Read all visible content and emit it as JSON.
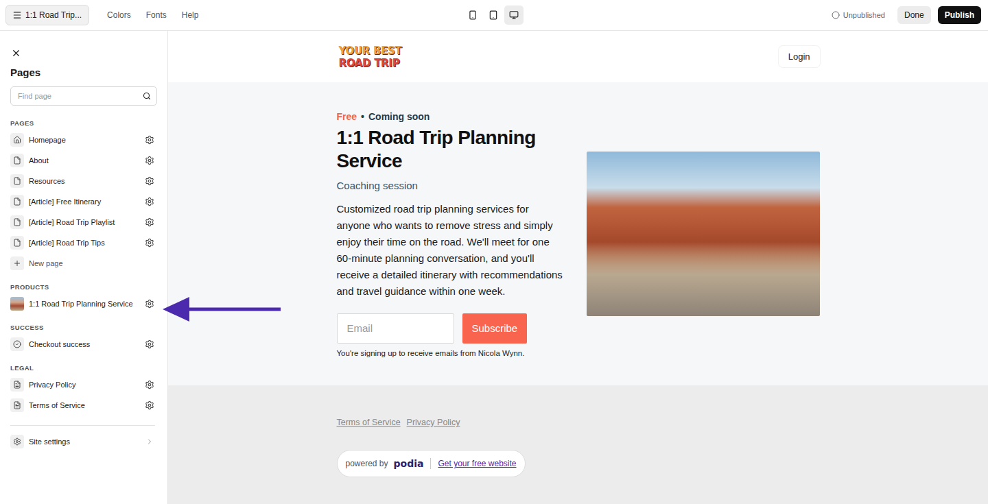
{
  "toolbar": {
    "site_title": "1:1 Road Trip...",
    "menu": [
      "Colors",
      "Fonts",
      "Help"
    ],
    "devices": [
      {
        "kind": "mobile",
        "selected": false
      },
      {
        "kind": "tablet",
        "selected": false
      },
      {
        "kind": "desktop",
        "selected": true
      }
    ],
    "status": "Unpublished",
    "buttons": [
      {
        "label": "Done",
        "kind": "secondary"
      },
      {
        "label": "Publish",
        "kind": "primary"
      }
    ]
  },
  "sidebar": {
    "title": "Pages",
    "search": {
      "placeholder": "Find page"
    },
    "sections": [
      {
        "label": "PAGES",
        "items": [
          {
            "label": "Homepage",
            "kind": "home"
          },
          {
            "label": "About",
            "kind": "page"
          },
          {
            "label": "Resources",
            "kind": "page"
          },
          {
            "label": "[Article] Free Itinerary",
            "kind": "page"
          },
          {
            "label": "[Article] Road Trip Playlist",
            "kind": "page"
          },
          {
            "label": "[Article] Road Trip Tips",
            "kind": "page"
          },
          {
            "label": "New page",
            "kind": "new"
          }
        ]
      },
      {
        "label": "PRODUCTS",
        "items": [
          {
            "label": "1:1 Road Trip Planning Service",
            "kind": "product"
          }
        ]
      },
      {
        "label": "SUCCESS",
        "items": [
          {
            "label": "Checkout success",
            "kind": "success"
          }
        ]
      },
      {
        "label": "LEGAL",
        "items": [
          {
            "label": "Privacy Policy",
            "kind": "legal"
          },
          {
            "label": "Terms of Service",
            "kind": "legal"
          }
        ]
      }
    ],
    "settings": {
      "label": "Site settings"
    }
  },
  "preview": {
    "logo": [
      "YOUR BEST",
      "ROAD TRIP"
    ],
    "login": "Login",
    "price": "Free",
    "separator": "•",
    "availability": "Coming soon",
    "title": "1:1 Road Trip Planning Service",
    "subtitle": "Coaching session",
    "description": "Customized road trip planning services for anyone who wants to remove stress and simply enjoy their time on the road. We'll meet for one 60-minute planning conversation, and you'll receive a detailed itinerary with recommendations and travel guidance within one week.",
    "email_placeholder": "Email",
    "subscribe": "Subscribe",
    "consent": "You're signing up to receive emails from Nicola Wynn.",
    "footer_links": [
      "Terms of Service",
      "Privacy Policy"
    ],
    "badge": {
      "prefix": "powered by",
      "brand": "podia",
      "link": "Get your free website"
    }
  }
}
